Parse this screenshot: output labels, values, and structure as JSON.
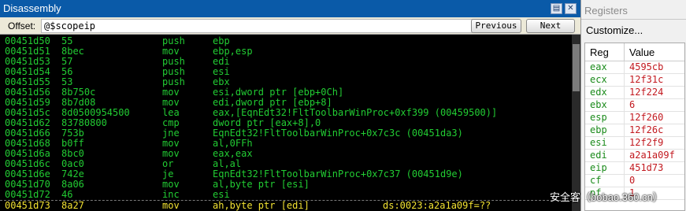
{
  "disassembly": {
    "title": "Disassembly",
    "offset_label": "Offset:",
    "offset_value": "@$scopeip",
    "previous_label": "Previous",
    "next_label": "Next",
    "lines": [
      {
        "addr": "00451d50",
        "bytes": "55",
        "mn": "push",
        "op": "ebp",
        "ann": ""
      },
      {
        "addr": "00451d51",
        "bytes": "8bec",
        "mn": "mov",
        "op": "ebp,esp",
        "ann": ""
      },
      {
        "addr": "00451d53",
        "bytes": "57",
        "mn": "push",
        "op": "edi",
        "ann": ""
      },
      {
        "addr": "00451d54",
        "bytes": "56",
        "mn": "push",
        "op": "esi",
        "ann": ""
      },
      {
        "addr": "00451d55",
        "bytes": "53",
        "mn": "push",
        "op": "ebx",
        "ann": ""
      },
      {
        "addr": "00451d56",
        "bytes": "8b750c",
        "mn": "mov",
        "op": "esi,dword ptr [ebp+0Ch]",
        "ann": ""
      },
      {
        "addr": "00451d59",
        "bytes": "8b7d08",
        "mn": "mov",
        "op": "edi,dword ptr [ebp+8]",
        "ann": ""
      },
      {
        "addr": "00451d5c",
        "bytes": "8d0500954500",
        "mn": "lea",
        "op": "eax,[EqnEdt32!FltToolbarWinProc+0xf399 (00459500)]",
        "ann": ""
      },
      {
        "addr": "00451d62",
        "bytes": "83780800",
        "mn": "cmp",
        "op": "dword ptr [eax+8],0",
        "ann": ""
      },
      {
        "addr": "00451d66",
        "bytes": "753b",
        "mn": "jne",
        "op": "EqnEdt32!FltToolbarWinProc+0x7c3c (00451da3)",
        "ann": ""
      },
      {
        "addr": "00451d68",
        "bytes": "b0ff",
        "mn": "mov",
        "op": "al,0FFh",
        "ann": ""
      },
      {
        "addr": "00451d6a",
        "bytes": "8bc0",
        "mn": "mov",
        "op": "eax,eax",
        "ann": ""
      },
      {
        "addr": "00451d6c",
        "bytes": "0ac0",
        "mn": "or",
        "op": "al,al",
        "ann": ""
      },
      {
        "addr": "00451d6e",
        "bytes": "742e",
        "mn": "je",
        "op": "EqnEdt32!FltToolbarWinProc+0x7c37 (00451d9e)",
        "ann": ""
      },
      {
        "addr": "00451d70",
        "bytes": "8a06",
        "mn": "mov",
        "op": "al,byte ptr [esi]",
        "ann": ""
      },
      {
        "addr": "00451d72",
        "bytes": "46",
        "mn": "inc",
        "op": "esi",
        "ann": ""
      },
      {
        "addr": "00451d73",
        "bytes": "8a27",
        "mn": "mov",
        "op": "ah,byte ptr [edi]",
        "ann": "ds:0023:a2a1a09f=??"
      }
    ]
  },
  "registers": {
    "title": "Registers",
    "customize_label": "Customize...",
    "col_reg": "Reg",
    "col_value": "Value",
    "rows": [
      {
        "name": "eax",
        "value": "4595cb"
      },
      {
        "name": "ecx",
        "value": "12f31c"
      },
      {
        "name": "edx",
        "value": "12f224"
      },
      {
        "name": "ebx",
        "value": "6"
      },
      {
        "name": "esp",
        "value": "12f260"
      },
      {
        "name": "ebp",
        "value": "12f26c"
      },
      {
        "name": "esi",
        "value": "12f2f9"
      },
      {
        "name": "edi",
        "value": "a2a1a09f"
      },
      {
        "name": "eip",
        "value": "451d73"
      },
      {
        "name": "cf",
        "value": "0"
      },
      {
        "name": "pf",
        "value": "1"
      }
    ]
  },
  "watermark": "安全客（bobao.360.cn）",
  "colors": {
    "code_text": "#22cc33",
    "current_line": "#f2e232",
    "reg_name": "#1a8a1a",
    "reg_value": "#c2191f",
    "title_bar": "#0a5aa8"
  }
}
